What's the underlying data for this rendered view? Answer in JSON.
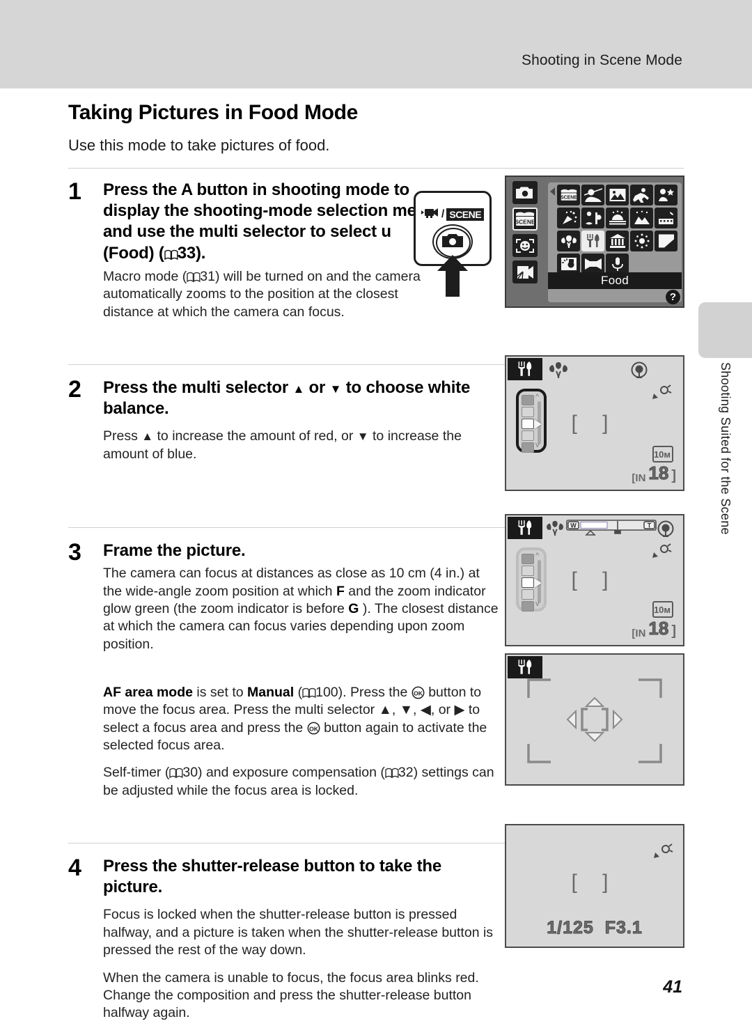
{
  "header": {
    "running_head": "Shooting in Scene Mode"
  },
  "side_tab": {
    "label": "Shooting Suited for the Scene"
  },
  "title": "Taking Pictures in Food Mode",
  "intro": "Use this mode to take pictures of food.",
  "steps": [
    {
      "number": "1",
      "heading_parts": {
        "a": "Press the A",
        "b": " button in shooting mode to display the shooting-mode selection menu and use the multi selector to select u",
        "c": " (Food) (",
        "page_ref": "33",
        "d": ")."
      },
      "body": [
        {
          "a": "Macro mode (",
          "page_ref": "31",
          "b": ") will be turned on and the camera automatically zooms to the position at the closest distance at which the camera can focus."
        }
      ]
    },
    {
      "number": "2",
      "heading_parts": {
        "a": "Press the multi selector ",
        "up": "▲",
        "b": " or ",
        "down": "▼",
        "c": " to choose white balance."
      },
      "body": [
        {
          "a": "Press ",
          "up": "▲",
          "b": " to increase the amount of red, or ",
          "down": "▼",
          "c": " to increase the amount of blue."
        }
      ]
    },
    {
      "number": "3",
      "heading": "Frame the picture.",
      "body": [
        {
          "a": "The camera can focus at distances as close as 10 cm (4 in.) at the wide-angle zoom position at which ",
          "sym1": "F",
          "b": " and the zoom indicator glow green (the zoom indicator is before ",
          "sym2": "G",
          "c": " ). The closest distance at which the camera can focus varies depending upon zoom position."
        }
      ]
    },
    {
      "number": "4",
      "heading": "Press the shutter-release button to take the picture.",
      "body": [
        {
          "text": "Focus is locked when the shutter-release button is pressed halfway, and a picture is taken when the shutter-release button is pressed the rest of the way down."
        },
        {
          "text": "When the camera is unable to focus, the focus area blinks red. Change the composition and press the shutter-release button halfway again."
        }
      ]
    }
  ],
  "af_note": {
    "a": "AF area mode",
    "b": " is set to ",
    "c": "Manual",
    "d": " (",
    "page_ref": "100",
    "e": "). Press the ",
    "f": " button to move the focus area. Press the multi selector ",
    "arrows": "▲, ▼, ◀, or ▶",
    "g": " to select a focus area and press the ",
    "h": " button again to activate the selected focus area."
  },
  "selftimer_note": {
    "a": "Self-timer (",
    "page_ref_1": "30",
    "b": ") and exposure compensation (",
    "page_ref_2": "32",
    "c": ") settings can be adjusted while the focus area is locked."
  },
  "mode_button_figure": {
    "movie_icon": "movie-camera-icon",
    "separator": "/",
    "scene_label": "SCENE",
    "camera_icon": "camera-icon",
    "arrow_icon": "up-arrow-icon"
  },
  "scene_menu": {
    "sidebar": [
      {
        "name": "auto-mode-icon"
      },
      {
        "name": "scene-mode-icon",
        "label": "SCENE",
        "selected": true
      },
      {
        "name": "smart-portrait-icon"
      },
      {
        "name": "movie-mode-icon"
      }
    ],
    "grid": [
      {
        "name": "scene-auto-selector-icon",
        "label": "SCENE"
      },
      {
        "name": "portrait-icon"
      },
      {
        "name": "landscape-icon"
      },
      {
        "name": "sports-icon"
      },
      {
        "name": "night-portrait-icon"
      },
      {
        "name": "party-indoor-icon"
      },
      {
        "name": "beach-snow-icon"
      },
      {
        "name": "sunset-icon"
      },
      {
        "name": "dusk-dawn-icon"
      },
      {
        "name": "night-landscape-icon"
      },
      {
        "name": "close-up-icon"
      },
      {
        "name": "food-icon",
        "selected": true
      },
      {
        "name": "museum-icon"
      },
      {
        "name": "fireworks-icon"
      },
      {
        "name": "copy-icon"
      },
      {
        "name": "backlight-icon"
      },
      {
        "name": "panorama-assist-icon"
      },
      {
        "name": "voice-recording-icon"
      }
    ],
    "selected_label": "Food",
    "help_badge": "?"
  },
  "monitor_wb": {
    "food_badge": "food-icon",
    "macro_icon": "macro-flower-icon",
    "white_balance_icon": "white-balance-icon",
    "shake_icon": "camera-shake-icon",
    "focus_brackets": "[  ]",
    "quality": "10m",
    "memory": "IN",
    "shots_remaining": "18",
    "wb_swatch_count": 5,
    "wb_selected_index": 2
  },
  "monitor_zoom": {
    "food_badge": "food-icon",
    "macro_icon": "macro-flower-icon",
    "zoom_wide": "W",
    "zoom_tele": "T",
    "white_balance_icon": "white-balance-icon",
    "shake_icon": "camera-shake-icon",
    "focus_brackets": "[  ]",
    "quality": "10m",
    "memory": "IN",
    "shots_remaining": "18"
  },
  "monitor_focus_area": {
    "food_badge": "food-icon",
    "center_icon": "focus-area-move-icon"
  },
  "monitor_exposure": {
    "shake_icon": "camera-shake-icon",
    "focus_brackets": "[  ]",
    "shutter_speed": "1/125",
    "aperture": "F3.1"
  },
  "page_number": "41",
  "colors": {
    "header_band": "#d6d6d6",
    "tab": "#d2d2d2",
    "lcd_bg": "#d8d8d8",
    "menu_bg": "#6f6f6f",
    "menu_panel": "#9a9a9a",
    "icon_dark": "#1f1f1f"
  }
}
